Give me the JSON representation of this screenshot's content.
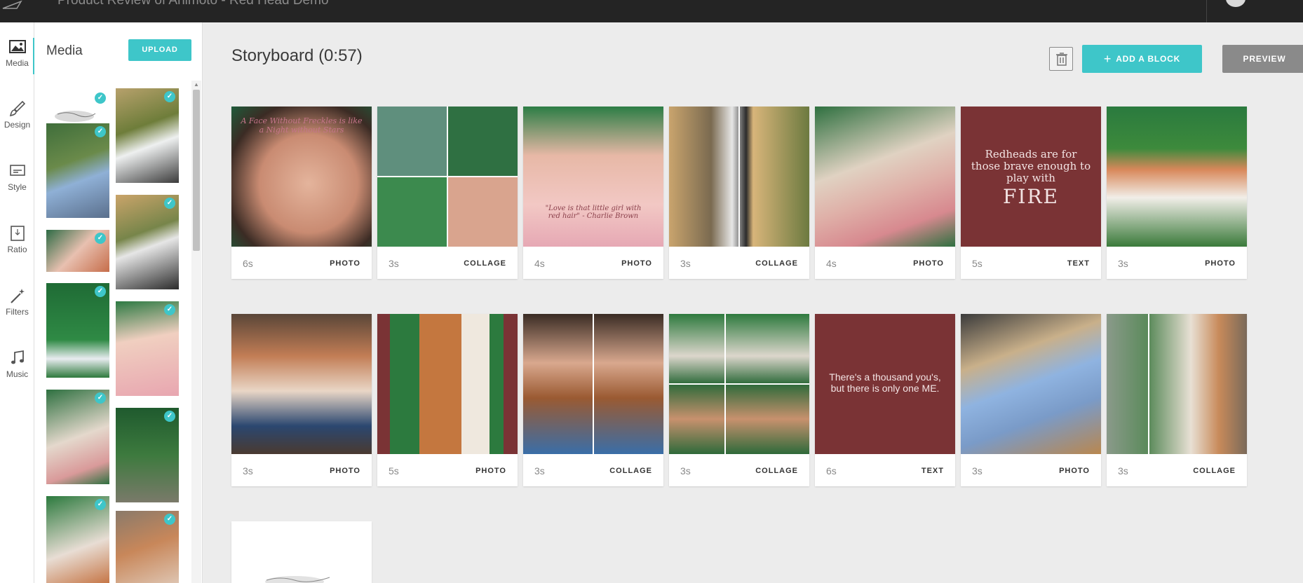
{
  "app": {
    "title": "Product Review of Animoto - Red Head Demo"
  },
  "rail": [
    {
      "label": "Media",
      "icon": "image-icon"
    },
    {
      "label": "Design",
      "icon": "brush-icon"
    },
    {
      "label": "Style",
      "icon": "style-icon"
    },
    {
      "label": "Ratio",
      "icon": "ratio-icon"
    },
    {
      "label": "Filters",
      "icon": "magic-wand-icon"
    },
    {
      "label": "Music",
      "icon": "music-note-icon"
    }
  ],
  "media": {
    "title": "Media",
    "upload_label": "UPLOAD"
  },
  "storyboard": {
    "title": "Storyboard (0:57)",
    "add_block_label": "ADD A BLOCK",
    "preview_label": "PREVIEW"
  },
  "blocks": [
    {
      "duration": "6s",
      "type": "PHOTO",
      "quote": "A Face Without Freckles is like a Night without Stars"
    },
    {
      "duration": "3s",
      "type": "COLLAGE"
    },
    {
      "duration": "4s",
      "type": "PHOTO",
      "quote": "\"Love is that little girl with red hair\" - Charlie Brown"
    },
    {
      "duration": "3s",
      "type": "COLLAGE"
    },
    {
      "duration": "4s",
      "type": "PHOTO"
    },
    {
      "duration": "5s",
      "type": "TEXT",
      "text_line1": "Redheads are for those brave enough to play with",
      "text_line2": "FIRE"
    },
    {
      "duration": "3s",
      "type": "PHOTO"
    },
    {
      "duration": "3s",
      "type": "PHOTO"
    },
    {
      "duration": "5s",
      "type": "PHOTO"
    },
    {
      "duration": "3s",
      "type": "COLLAGE"
    },
    {
      "duration": "3s",
      "type": "COLLAGE"
    },
    {
      "duration": "6s",
      "type": "TEXT",
      "text_line1": "There's a thousand you's, but there is only one ME."
    },
    {
      "duration": "3s",
      "type": "PHOTO"
    },
    {
      "duration": "3s",
      "type": "COLLAGE"
    }
  ],
  "colors": {
    "accent": "#3ec6c9",
    "text_block_bg": "#7a3335",
    "topbar": "#242424"
  }
}
